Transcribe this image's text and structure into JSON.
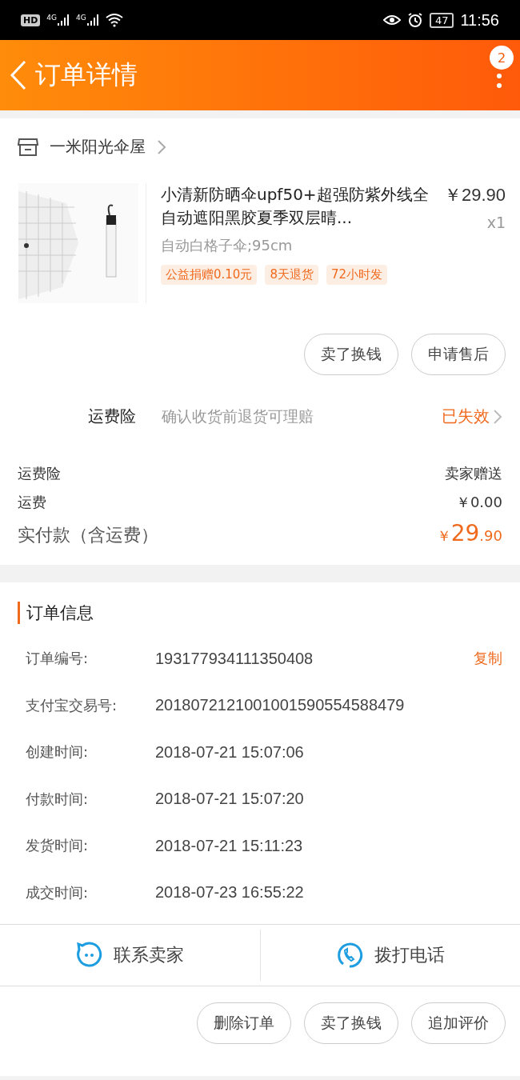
{
  "status_bar": {
    "hd": "HD",
    "networks": [
      "4G",
      "4G"
    ],
    "battery": "47",
    "time": "11:56"
  },
  "header": {
    "title": "订单详情",
    "badge": "2"
  },
  "shop": {
    "name": "一米阳光伞屋"
  },
  "product": {
    "kind": "picture",
    "title": "小清新防晒伞upf50+超强防紫外线全自动遮阳黑胶夏季双层晴...",
    "price": "￥29.90",
    "quantity": "x1",
    "sku": "自动白格子伞;95cm",
    "tags": [
      "公益捐赠0.10元",
      "8天退货",
      "72小时发"
    ],
    "buttons": [
      "卖了换钱",
      "申请售后"
    ]
  },
  "insurance": {
    "label": "运费险",
    "desc": "确认收货前退货可理赔",
    "status": "已失效"
  },
  "fees": [
    {
      "label": "运费险",
      "value": "卖家赠送"
    },
    {
      "label": "运费",
      "value": "￥0.00"
    }
  ],
  "total": {
    "label": "实付款（含运费）",
    "symbol": "￥",
    "integer": "29",
    "decimal": ".90"
  },
  "order_info": {
    "title": "订单信息",
    "rows": [
      {
        "label": "订单编号:",
        "value": "193177934111350408",
        "action": "复制"
      },
      {
        "label": "支付宝交易号:",
        "value": "2018072121001001590554588479"
      },
      {
        "label": "创建时间:",
        "value": "2018-07-21 15:07:06"
      },
      {
        "label": "付款时间:",
        "value": "2018-07-21 15:07:20"
      },
      {
        "label": "发货时间:",
        "value": "2018-07-21 15:11:23"
      },
      {
        "label": "成交时间:",
        "value": "2018-07-23 16:55:22"
      }
    ]
  },
  "contact": [
    {
      "kind": "chat",
      "label": "联系卖家"
    },
    {
      "kind": "phone",
      "label": "拨打电话"
    }
  ],
  "actions": [
    "删除订单",
    "卖了换钱",
    "追加评价"
  ]
}
